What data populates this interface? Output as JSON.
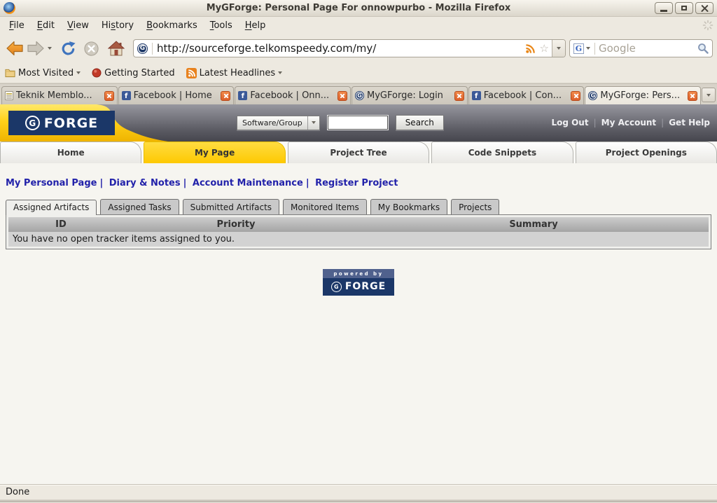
{
  "window": {
    "title": "MyGForge: Personal Page For onnowpurbo - Mozilla Firefox"
  },
  "menubar": {
    "items": [
      {
        "text": "File",
        "u": 0
      },
      {
        "text": "Edit",
        "u": 0
      },
      {
        "text": "View",
        "u": 0
      },
      {
        "text": "History",
        "u": 2
      },
      {
        "text": "Bookmarks",
        "u": 0
      },
      {
        "text": "Tools",
        "u": 0
      },
      {
        "text": "Help",
        "u": 0
      }
    ]
  },
  "navbar": {
    "url": "http://sourceforge.telkomspeedy.com/my/",
    "search_placeholder": "Google"
  },
  "bookmarks_bar": {
    "items": [
      "Most Visited",
      "Getting Started",
      "Latest Headlines"
    ]
  },
  "tabstrip": {
    "tabs": [
      {
        "label": "Teknik Memblo...",
        "favicon": "document",
        "active": false
      },
      {
        "label": "Facebook | Home",
        "favicon": "facebook",
        "active": false
      },
      {
        "label": "Facebook | Onn...",
        "favicon": "facebook",
        "active": false
      },
      {
        "label": "MyGForge: Login",
        "favicon": "gforge",
        "active": false
      },
      {
        "label": "Facebook | Con...",
        "favicon": "gforge-facebook",
        "active": false
      },
      {
        "label": "MyGForge: Pers...",
        "favicon": "gforge",
        "active": true
      }
    ]
  },
  "icons": {
    "facebook_f": "f",
    "gforge_g": "G",
    "star": "☆"
  },
  "gforge": {
    "logo": {
      "g": "G",
      "text": "FORGE"
    },
    "header_search": {
      "category": "Software/Group",
      "query": "",
      "button": "Search"
    },
    "separator": "|",
    "account_links": [
      "Log Out",
      "My Account",
      "Get Help"
    ],
    "nav_tabs": [
      {
        "label": "Home",
        "active": false
      },
      {
        "label": "My Page",
        "active": true
      },
      {
        "label": "Project Tree",
        "active": false
      },
      {
        "label": "Code Snippets",
        "active": false
      },
      {
        "label": "Project Openings",
        "active": false
      }
    ],
    "personal_links": [
      "My Personal Page",
      "Diary & Notes",
      "Account Maintenance",
      "Register Project"
    ],
    "sub_tabs": [
      {
        "label": "Assigned Artifacts",
        "active": true
      },
      {
        "label": "Assigned Tasks",
        "active": false
      },
      {
        "label": "Submitted Artifacts",
        "active": false
      },
      {
        "label": "Monitored Items",
        "active": false
      },
      {
        "label": "My Bookmarks",
        "active": false
      },
      {
        "label": "Projects",
        "active": false
      }
    ],
    "artifacts_table": {
      "headers": [
        "ID",
        "Priority",
        "Summary"
      ],
      "empty_message": "You have no open tracker items assigned to you."
    },
    "powered_by": {
      "line1": "powered by",
      "g": "G",
      "line2": "FORGE"
    }
  },
  "statusbar": {
    "text": "Done"
  },
  "colors": {
    "gforge_navy": "#1B3768",
    "gforge_yellow": "#FFD119",
    "header_slate_top": "#97979F",
    "header_slate_bottom": "#46464E",
    "link_blue": "#2222AA",
    "tab_close_orange": "#DD5F2A",
    "chrome_beige": "#EDE9E0"
  }
}
